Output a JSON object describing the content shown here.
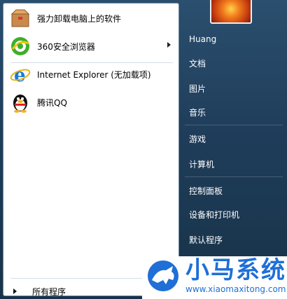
{
  "programs": [
    {
      "label": "强力卸载电脑上的软件",
      "icon": "uninstaller-box-icon"
    },
    {
      "label": "360安全浏览器",
      "icon": "360-browser-icon",
      "has_submenu": true
    },
    {
      "label": "Internet Explorer (无加载项)",
      "icon": "internet-explorer-icon"
    },
    {
      "label": "腾讯QQ",
      "icon": "qq-penguin-icon"
    }
  ],
  "all_programs_label": "所有程序",
  "right_pane": {
    "items": [
      "Huang",
      "文档",
      "图片",
      "音乐",
      "游戏",
      "计算机",
      "控制面板",
      "设备和打印机",
      "默认程序"
    ]
  },
  "watermark": {
    "brand": "小马系统",
    "url": "www.xiaomaxitong.com"
  }
}
